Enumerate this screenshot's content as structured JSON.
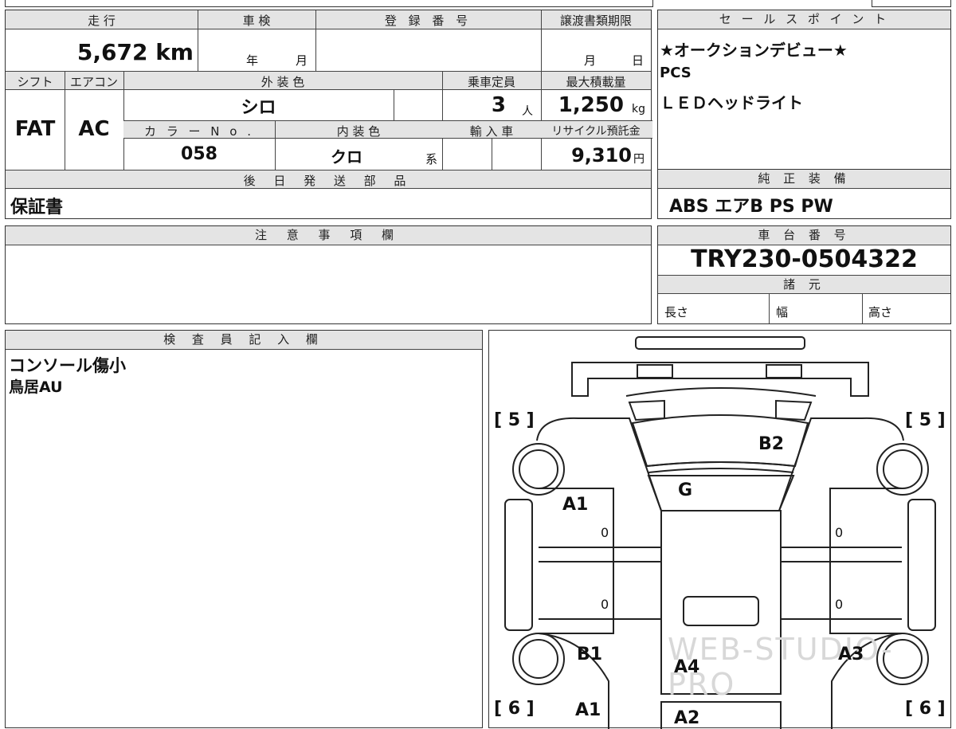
{
  "top_info": {
    "headers": {
      "mileage": "走 行",
      "inspection": "車 検",
      "registration": "登 録 番 号",
      "transfer_deadline": "譲渡書類期限",
      "shift": "シフト",
      "aircon": "エアコン",
      "exterior_color": "外 装 色",
      "capacity": "乗車定員",
      "max_load": "最大積載量",
      "color_no": "カ ラ ー N o .",
      "interior_color": "内 装 色",
      "import": "輸 入 車",
      "recycle": "リサイクル預託金",
      "later_parts": "後 日 発 送 部 品"
    },
    "mileage_value": "5,672 km",
    "inspection_year_unit": "年",
    "inspection_month_unit": "月",
    "transfer_month_unit": "月",
    "transfer_day_unit": "日",
    "shift_value": "FAT",
    "aircon_value": "AC",
    "exterior_color_value": "シロ",
    "capacity_value": "3",
    "capacity_unit": "人",
    "max_load_value": "1,250",
    "max_load_unit": "kg",
    "color_no_value": "058",
    "interior_color_value": "クロ",
    "interior_color_suffix": "系",
    "recycle_value": "9,310",
    "recycle_unit": "円",
    "later_parts_value": "保証書"
  },
  "sales_points": {
    "header": "セ ー ル ス ポ イ ン ト",
    "lines": [
      "★オークションデビュー★",
      "PCS",
      "ＬＥＤヘッドライト"
    ]
  },
  "equipment": {
    "header": "純 正 装 備",
    "value": "ABS エアB PS PW"
  },
  "notes": {
    "header": "注 意 事 項 欄"
  },
  "chassis": {
    "header": "車 台 番 号",
    "value": "TRY230-0504322",
    "specs_header": "諸 元",
    "length_label": "長さ",
    "width_label": "幅",
    "height_label": "高さ"
  },
  "inspector": {
    "header": "検 査 員 記 入 欄",
    "lines": [
      "コンソール傷小",
      "鳥居AU"
    ]
  },
  "diagram": {
    "watermark": "WEB-STUDIO-PRO",
    "labels": {
      "left_front": "[ 5 ]",
      "right_front": "[ 5 ]",
      "left_rear": "[ 6 ]",
      "right_rear": "[ 6 ]",
      "b2": "B2",
      "g": "G",
      "a1_left": "A1",
      "zero_1": "0",
      "zero_2": "0",
      "zero_3": "0",
      "zero_4": "0",
      "b1": "B1",
      "a4": "A4",
      "a3": "A3",
      "a1_bottom": "A1",
      "a2_bottom": "A2"
    }
  }
}
